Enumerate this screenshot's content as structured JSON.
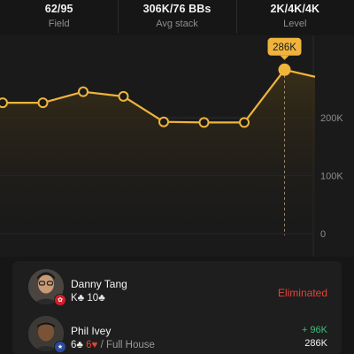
{
  "stats": [
    {
      "value": "62/95",
      "label": "Field"
    },
    {
      "value": "306K/76 BBs",
      "label": "Avg stack"
    },
    {
      "value": "2K/4K/4K",
      "label": "Level"
    }
  ],
  "chart_data": {
    "type": "line",
    "x": [
      1,
      2,
      3,
      4,
      5,
      6,
      7,
      8,
      9
    ],
    "values": [
      229,
      229,
      248,
      240,
      196,
      195,
      195,
      286,
      270
    ],
    "y_ticks": [
      {
        "value": 200,
        "label": "200K"
      },
      {
        "value": 100,
        "label": "100K"
      },
      {
        "value": 0,
        "label": "0"
      }
    ],
    "ylim": [
      0,
      330
    ],
    "highlight_index": 7,
    "highlight_label": "286K",
    "colors": {
      "line": "#f0b43c",
      "point_fill": "#1a1a1a",
      "highlight_fill": "#f0b43c"
    }
  },
  "players": [
    {
      "name": "Danny Tang",
      "hand": [
        {
          "text": "K",
          "color": "white"
        },
        {
          "text": "♣",
          "color": "white"
        },
        {
          "text": " 10",
          "color": "white"
        },
        {
          "text": "♣",
          "color": "white"
        }
      ],
      "status": "Eliminated",
      "badge_icon": "hong-kong-flag-icon"
    },
    {
      "name": "Phil Ivey",
      "hand": [
        {
          "text": "6",
          "color": "white"
        },
        {
          "text": "♣",
          "color": "white"
        },
        {
          "text": " 6",
          "color": "red"
        },
        {
          "text": "♥",
          "color": "red"
        },
        {
          "text": " / Full House",
          "color": "muted"
        }
      ],
      "gain": "+ 96K",
      "stack": "286K",
      "badge_icon": "us-flag-icon"
    }
  ]
}
